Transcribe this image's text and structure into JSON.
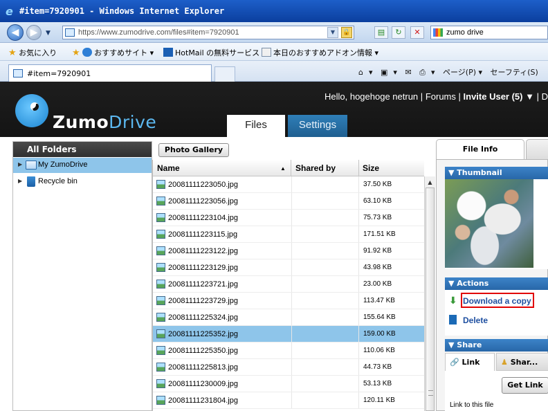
{
  "window": {
    "title": "#item=7920901 - Windows Internet Explorer"
  },
  "browser": {
    "url": "https://www.zumodrive.com/files#item=7920901",
    "search_query": "zumo drive",
    "favorites": [
      "お気に入り",
      "おすすめサイト ▾",
      "HotMail の無料サービス",
      "本日のおすすめアドオン情報 ▾"
    ],
    "tab_label": "#item=7920901",
    "command_bar": [
      "▾",
      "▾",
      "▾",
      "ページ(P) ▾",
      "セーフティ(S)"
    ]
  },
  "app": {
    "logo_main": "Zumo",
    "logo_accent": "Drive",
    "user_bar": {
      "greeting": "Hello, hogehoge netrun",
      "forums": "Forums",
      "invite": "Invite User (5) ▼",
      "separator": "|",
      "tail": "D"
    },
    "tabs": [
      "Files",
      "Settings"
    ]
  },
  "sidebar": {
    "header": "All Folders",
    "items": [
      {
        "label": "My ZumoDrive",
        "icon": "folder-icon",
        "selected": true
      },
      {
        "label": "Recycle bin",
        "icon": "trash-icon",
        "selected": false
      }
    ]
  },
  "filelist": {
    "gallery_button": "Photo Gallery",
    "columns": {
      "name": "Name",
      "sort_indicator": "▲",
      "shared_by": "Shared by",
      "size": "Size"
    },
    "rows": [
      {
        "name": "20081111223050.jpg",
        "size": "37.50 KB",
        "selected": false
      },
      {
        "name": "20081111223056.jpg",
        "size": "63.10 KB",
        "selected": false
      },
      {
        "name": "20081111223104.jpg",
        "size": "75.73 KB",
        "selected": false
      },
      {
        "name": "20081111223115.jpg",
        "size": "171.51 KB",
        "selected": false
      },
      {
        "name": "20081111223122.jpg",
        "size": "91.92 KB",
        "selected": false
      },
      {
        "name": "20081111223129.jpg",
        "size": "43.98 KB",
        "selected": false
      },
      {
        "name": "20081111223721.jpg",
        "size": "23.00 KB",
        "selected": false
      },
      {
        "name": "20081111223729.jpg",
        "size": "113.47 KB",
        "selected": false
      },
      {
        "name": "20081111225324.jpg",
        "size": "155.64 KB",
        "selected": false
      },
      {
        "name": "20081111225352.jpg",
        "size": "159.00 KB",
        "selected": true
      },
      {
        "name": "20081111225350.jpg",
        "size": "110.06 KB",
        "selected": false
      },
      {
        "name": "20081111225813.jpg",
        "size": "44.73 KB",
        "selected": false
      },
      {
        "name": "20081111230009.jpg",
        "size": "53.13 KB",
        "selected": false
      },
      {
        "name": "20081111231804.jpg",
        "size": "120.11 KB",
        "selected": false
      }
    ]
  },
  "infopanel": {
    "tab_active": "File Info",
    "thumbnail_header": "▼ Thumbnail",
    "actions_header": "▼ Actions",
    "download_label": "Download a copy",
    "delete_label": "Delete",
    "share_header": "▼ Share",
    "share_tabs": [
      "Link",
      "Shar..."
    ],
    "get_link_button": "Get Link",
    "link_caption": "Link to this file"
  },
  "colors": {
    "accent_blue": "#2867a8",
    "selection": "#8ec5ea",
    "highlight_box": "#e10000"
  }
}
